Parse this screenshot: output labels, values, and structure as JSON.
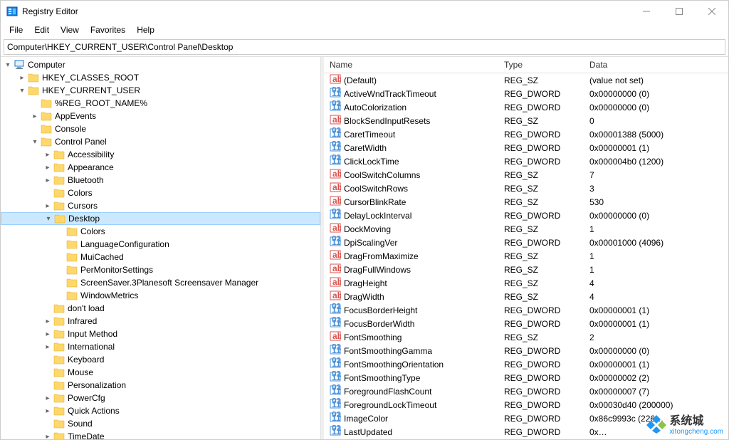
{
  "window": {
    "title": "Registry Editor"
  },
  "menu": {
    "file": "File",
    "edit": "Edit",
    "view": "View",
    "favorites": "Favorites",
    "help": "Help"
  },
  "address": "Computer\\HKEY_CURRENT_USER\\Control Panel\\Desktop",
  "tree": {
    "root": "Computer",
    "nodes": [
      {
        "label": "HKEY_CLASSES_ROOT",
        "depth": 1,
        "expand": "right"
      },
      {
        "label": "HKEY_CURRENT_USER",
        "depth": 1,
        "expand": "down"
      },
      {
        "label": "%REG_ROOT_NAME%",
        "depth": 2,
        "expand": ""
      },
      {
        "label": "AppEvents",
        "depth": 2,
        "expand": "right"
      },
      {
        "label": "Console",
        "depth": 2,
        "expand": ""
      },
      {
        "label": "Control Panel",
        "depth": 2,
        "expand": "down"
      },
      {
        "label": "Accessibility",
        "depth": 3,
        "expand": "right"
      },
      {
        "label": "Appearance",
        "depth": 3,
        "expand": "right"
      },
      {
        "label": "Bluetooth",
        "depth": 3,
        "expand": "right"
      },
      {
        "label": "Colors",
        "depth": 3,
        "expand": ""
      },
      {
        "label": "Cursors",
        "depth": 3,
        "expand": "right"
      },
      {
        "label": "Desktop",
        "depth": 3,
        "expand": "down",
        "selected": true
      },
      {
        "label": "Colors",
        "depth": 4,
        "expand": ""
      },
      {
        "label": "LanguageConfiguration",
        "depth": 4,
        "expand": ""
      },
      {
        "label": "MuiCached",
        "depth": 4,
        "expand": ""
      },
      {
        "label": "PerMonitorSettings",
        "depth": 4,
        "expand": ""
      },
      {
        "label": "ScreenSaver.3Planesoft Screensaver Manager",
        "depth": 4,
        "expand": ""
      },
      {
        "label": "WindowMetrics",
        "depth": 4,
        "expand": ""
      },
      {
        "label": "don't load",
        "depth": 3,
        "expand": ""
      },
      {
        "label": "Infrared",
        "depth": 3,
        "expand": "right"
      },
      {
        "label": "Input Method",
        "depth": 3,
        "expand": "right"
      },
      {
        "label": "International",
        "depth": 3,
        "expand": "right"
      },
      {
        "label": "Keyboard",
        "depth": 3,
        "expand": ""
      },
      {
        "label": "Mouse",
        "depth": 3,
        "expand": ""
      },
      {
        "label": "Personalization",
        "depth": 3,
        "expand": ""
      },
      {
        "label": "PowerCfg",
        "depth": 3,
        "expand": "right"
      },
      {
        "label": "Quick Actions",
        "depth": 3,
        "expand": "right"
      },
      {
        "label": "Sound",
        "depth": 3,
        "expand": ""
      },
      {
        "label": "TimeDate",
        "depth": 3,
        "expand": "right"
      }
    ]
  },
  "values": {
    "headers": {
      "name": "Name",
      "type": "Type",
      "data": "Data"
    },
    "rows": [
      {
        "icon": "sz",
        "name": "(Default)",
        "type": "REG_SZ",
        "data": "(value not set)"
      },
      {
        "icon": "dw",
        "name": "ActiveWndTrackTimeout",
        "type": "REG_DWORD",
        "data": "0x00000000 (0)"
      },
      {
        "icon": "dw",
        "name": "AutoColorization",
        "type": "REG_DWORD",
        "data": "0x00000000 (0)"
      },
      {
        "icon": "sz",
        "name": "BlockSendInputResets",
        "type": "REG_SZ",
        "data": "0"
      },
      {
        "icon": "dw",
        "name": "CaretTimeout",
        "type": "REG_DWORD",
        "data": "0x00001388 (5000)"
      },
      {
        "icon": "dw",
        "name": "CaretWidth",
        "type": "REG_DWORD",
        "data": "0x00000001 (1)"
      },
      {
        "icon": "dw",
        "name": "ClickLockTime",
        "type": "REG_DWORD",
        "data": "0x000004b0 (1200)"
      },
      {
        "icon": "sz",
        "name": "CoolSwitchColumns",
        "type": "REG_SZ",
        "data": "7"
      },
      {
        "icon": "sz",
        "name": "CoolSwitchRows",
        "type": "REG_SZ",
        "data": "3"
      },
      {
        "icon": "sz",
        "name": "CursorBlinkRate",
        "type": "REG_SZ",
        "data": "530"
      },
      {
        "icon": "dw",
        "name": "DelayLockInterval",
        "type": "REG_DWORD",
        "data": "0x00000000 (0)"
      },
      {
        "icon": "sz",
        "name": "DockMoving",
        "type": "REG_SZ",
        "data": "1"
      },
      {
        "icon": "dw",
        "name": "DpiScalingVer",
        "type": "REG_DWORD",
        "data": "0x00001000 (4096)"
      },
      {
        "icon": "sz",
        "name": "DragFromMaximize",
        "type": "REG_SZ",
        "data": "1"
      },
      {
        "icon": "sz",
        "name": "DragFullWindows",
        "type": "REG_SZ",
        "data": "1"
      },
      {
        "icon": "sz",
        "name": "DragHeight",
        "type": "REG_SZ",
        "data": "4"
      },
      {
        "icon": "sz",
        "name": "DragWidth",
        "type": "REG_SZ",
        "data": "4"
      },
      {
        "icon": "dw",
        "name": "FocusBorderHeight",
        "type": "REG_DWORD",
        "data": "0x00000001 (1)"
      },
      {
        "icon": "dw",
        "name": "FocusBorderWidth",
        "type": "REG_DWORD",
        "data": "0x00000001 (1)"
      },
      {
        "icon": "sz",
        "name": "FontSmoothing",
        "type": "REG_SZ",
        "data": "2"
      },
      {
        "icon": "dw",
        "name": "FontSmoothingGamma",
        "type": "REG_DWORD",
        "data": "0x00000000 (0)"
      },
      {
        "icon": "dw",
        "name": "FontSmoothingOrientation",
        "type": "REG_DWORD",
        "data": "0x00000001 (1)"
      },
      {
        "icon": "dw",
        "name": "FontSmoothingType",
        "type": "REG_DWORD",
        "data": "0x00000002 (2)"
      },
      {
        "icon": "dw",
        "name": "ForegroundFlashCount",
        "type": "REG_DWORD",
        "data": "0x00000007 (7)"
      },
      {
        "icon": "dw",
        "name": "ForegroundLockTimeout",
        "type": "REG_DWORD",
        "data": "0x00030d40 (200000)"
      },
      {
        "icon": "dw",
        "name": "ImageColor",
        "type": "REG_DWORD",
        "data": "0x86c9993c (226…"
      },
      {
        "icon": "dw",
        "name": "LastUpdated",
        "type": "REG_DWORD",
        "data": "0x…"
      }
    ]
  },
  "watermark": {
    "main": "系统城",
    "sub": "xitongcheng.com"
  }
}
